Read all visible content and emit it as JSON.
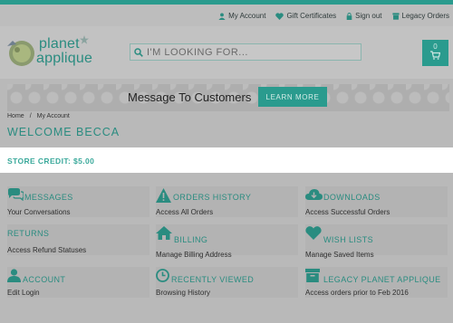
{
  "topbar": {
    "links": [
      {
        "label": "My Account",
        "icon": "user-icon"
      },
      {
        "label": "Gift Certificates",
        "icon": "heart-icon"
      },
      {
        "label": "Sign out",
        "icon": "lock-icon"
      },
      {
        "label": "Legacy Orders",
        "icon": "box-icon"
      }
    ]
  },
  "logo": {
    "line1": "planet",
    "line2": "applique"
  },
  "search": {
    "placeholder": "I'M LOOKING FOR..."
  },
  "cart": {
    "count": "0"
  },
  "banner": {
    "message": "Message To Customers",
    "button": "LEARN MORE"
  },
  "breadcrumb": {
    "home": "Home",
    "separator": "/",
    "current": "My Account"
  },
  "welcome": "WELCOME BECCA",
  "store_credit": "STORE CREDIT: $5.00",
  "cards": [
    {
      "title": "MESSAGES",
      "subtitle": "Your Conversations",
      "icon": "chat-icon"
    },
    {
      "title": "ORDERS HISTORY",
      "subtitle": "Access All Orders",
      "icon": "warning-icon"
    },
    {
      "title": "DOWNLOADS",
      "subtitle": "Access Successful Orders",
      "icon": "cloud-download-icon"
    },
    {
      "title": "RETURNS",
      "subtitle": "Access Refund Statuses",
      "icon": ""
    },
    {
      "title": "BILLING",
      "subtitle": "Manage Billing Address",
      "icon": "home-icon"
    },
    {
      "title": "WISH LISTS",
      "subtitle": "Manage Saved Items",
      "icon": "heart-icon"
    },
    {
      "title": "ACCOUNT",
      "subtitle": "Edit Login",
      "icon": "user-icon"
    },
    {
      "title": "RECENTLY VIEWED",
      "subtitle": "Browsing History",
      "icon": "clock-icon"
    },
    {
      "title": "LEGACY PLANET APPLIQUE",
      "subtitle": "Access orders prior to Feb 2016",
      "icon": "box-icon"
    }
  ],
  "colors": {
    "accent": "#2a9b8e",
    "overlay": "#b9b9b9",
    "highlight": "#ffffff"
  }
}
